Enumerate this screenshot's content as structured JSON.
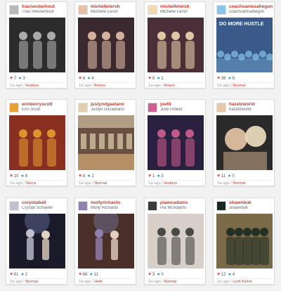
{
  "colors": {
    "username": "#c0392b",
    "heart": "#d9534f",
    "comment": "#3aa0c8",
    "meta": "#999999"
  },
  "cards": [
    {
      "username": "tracivesterhout",
      "fullname": "Traci Westerhout",
      "likes": "7",
      "comments": "3",
      "time": "1w ago",
      "filter": "Hudson",
      "photo_bg": "#2c2c2c",
      "photo_accent": "#b8b8b8",
      "photo_icon": "party-photo"
    },
    {
      "username": "michellelersh",
      "fullname": "Michelle Lersh",
      "likes": "6",
      "comments": "4",
      "time": "1w ago",
      "filter": "Amaro",
      "photo_bg": "#3a2a30",
      "photo_accent": "#e8c0a8",
      "photo_icon": "group-photo"
    },
    {
      "username": "michellelersh",
      "fullname": "Michelle Lersh",
      "likes": "8",
      "comments": "1",
      "time": "1w ago",
      "filter": "Amaro",
      "photo_bg": "#4a2e38",
      "photo_accent": "#f0d8b0",
      "photo_icon": "group-photo"
    },
    {
      "username": "coachsamesahegun",
      "fullname": "coachsamsahegun",
      "likes": "38",
      "comments": "6",
      "time": "1w ago",
      "filter": "Normal",
      "photo_bg": "#3b5a8a",
      "photo_accent": "#88c4e8",
      "photo_icon": "crowd-photo",
      "photo_text": "DO MORE HUSTLE"
    },
    {
      "username": "erinberryscott",
      "fullname": "Erin Scott",
      "likes": "10",
      "comments": "6",
      "time": "1w ago",
      "filter": "Sierra",
      "photo_bg": "#8a3020",
      "photo_accent": "#e8a030",
      "photo_icon": "party-photo"
    },
    {
      "username": "justyndgaetano",
      "fullname": "Justyn DiGaetano",
      "likes": "8",
      "comments": "2",
      "time": "1w ago",
      "filter": "Normal",
      "photo_bg": "#6a5040",
      "photo_accent": "#e0d0b0",
      "photo_icon": "gym-photo"
    },
    {
      "username": "joefit",
      "fullname": "Julie Poteet",
      "likes": "1",
      "comments": "3",
      "time": "1w ago",
      "filter": "Hudson",
      "photo_bg": "#2a2040",
      "photo_accent": "#d06090",
      "photo_icon": "group-photo"
    },
    {
      "username": "hazelzworld",
      "fullname": "hazelzworld",
      "likes": "11",
      "comments": "0",
      "time": "1w ago",
      "filter": "Normal",
      "photo_bg": "#2a2a2a",
      "photo_accent": "#e8c8a8",
      "photo_icon": "selfie-photo"
    },
    {
      "username": "coryotaball",
      "fullname": "Crystal Schaefer",
      "likes": "61",
      "comments": "2",
      "time": "1w ago",
      "filter": "Normal",
      "photo_bg": "#1a1a2a",
      "photo_accent": "#c0c0d0",
      "photo_icon": "stage-photo"
    },
    {
      "username": "mollyrichards",
      "fullname": "Molly Richards",
      "likes": "66",
      "comments": "11",
      "time": "1w ago",
      "filter": "Hefe",
      "photo_bg": "#4a3028",
      "photo_accent": "#9080b0",
      "photo_icon": "stage-photo"
    },
    {
      "username": "piamcadams",
      "fullname": "Pia McAdams",
      "likes": "3",
      "comments": "0",
      "time": "1w ago",
      "filter": "Normal",
      "photo_bg": "#d8d0c8",
      "photo_accent": "#3a3a3a",
      "photo_icon": "group-photo"
    },
    {
      "username": "shawnbuk",
      "fullname": "shawnbuk",
      "likes": "12",
      "comments": "4",
      "time": "1w ago",
      "filter": "Lord Kelvin",
      "photo_bg": "#7a6a48",
      "photo_accent": "#1a2a20",
      "photo_icon": "team-photo"
    }
  ]
}
